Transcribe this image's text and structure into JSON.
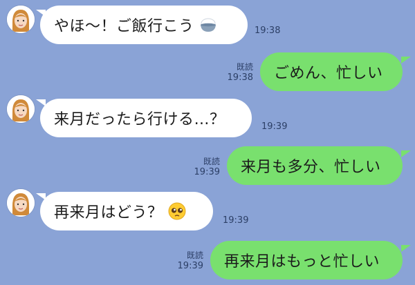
{
  "messages": [
    {
      "sender": "friend",
      "text": "やほ〜！ご飯行こう",
      "emoji": "rice-bowl-icon",
      "time": "19:38"
    },
    {
      "sender": "me",
      "text": "ごめん、忙しい",
      "read": "既読",
      "time": "19:38"
    },
    {
      "sender": "friend",
      "text": "来月だったら行ける…？",
      "time": "19:39"
    },
    {
      "sender": "me",
      "text": "来月も多分、忙しい",
      "read": "既読",
      "time": "19:39"
    },
    {
      "sender": "friend",
      "text": "再来月はどう？",
      "emoji": "pleading-face-icon",
      "time": "19:39"
    },
    {
      "sender": "me",
      "text": "再来月はもっと忙しい",
      "read": "既読",
      "time": "19:39"
    }
  ],
  "colors": {
    "background": "#8aa3d6",
    "incoming_bubble": "#ffffff",
    "outgoing_bubble": "#79e06e",
    "meta_text": "#2c3f66"
  }
}
